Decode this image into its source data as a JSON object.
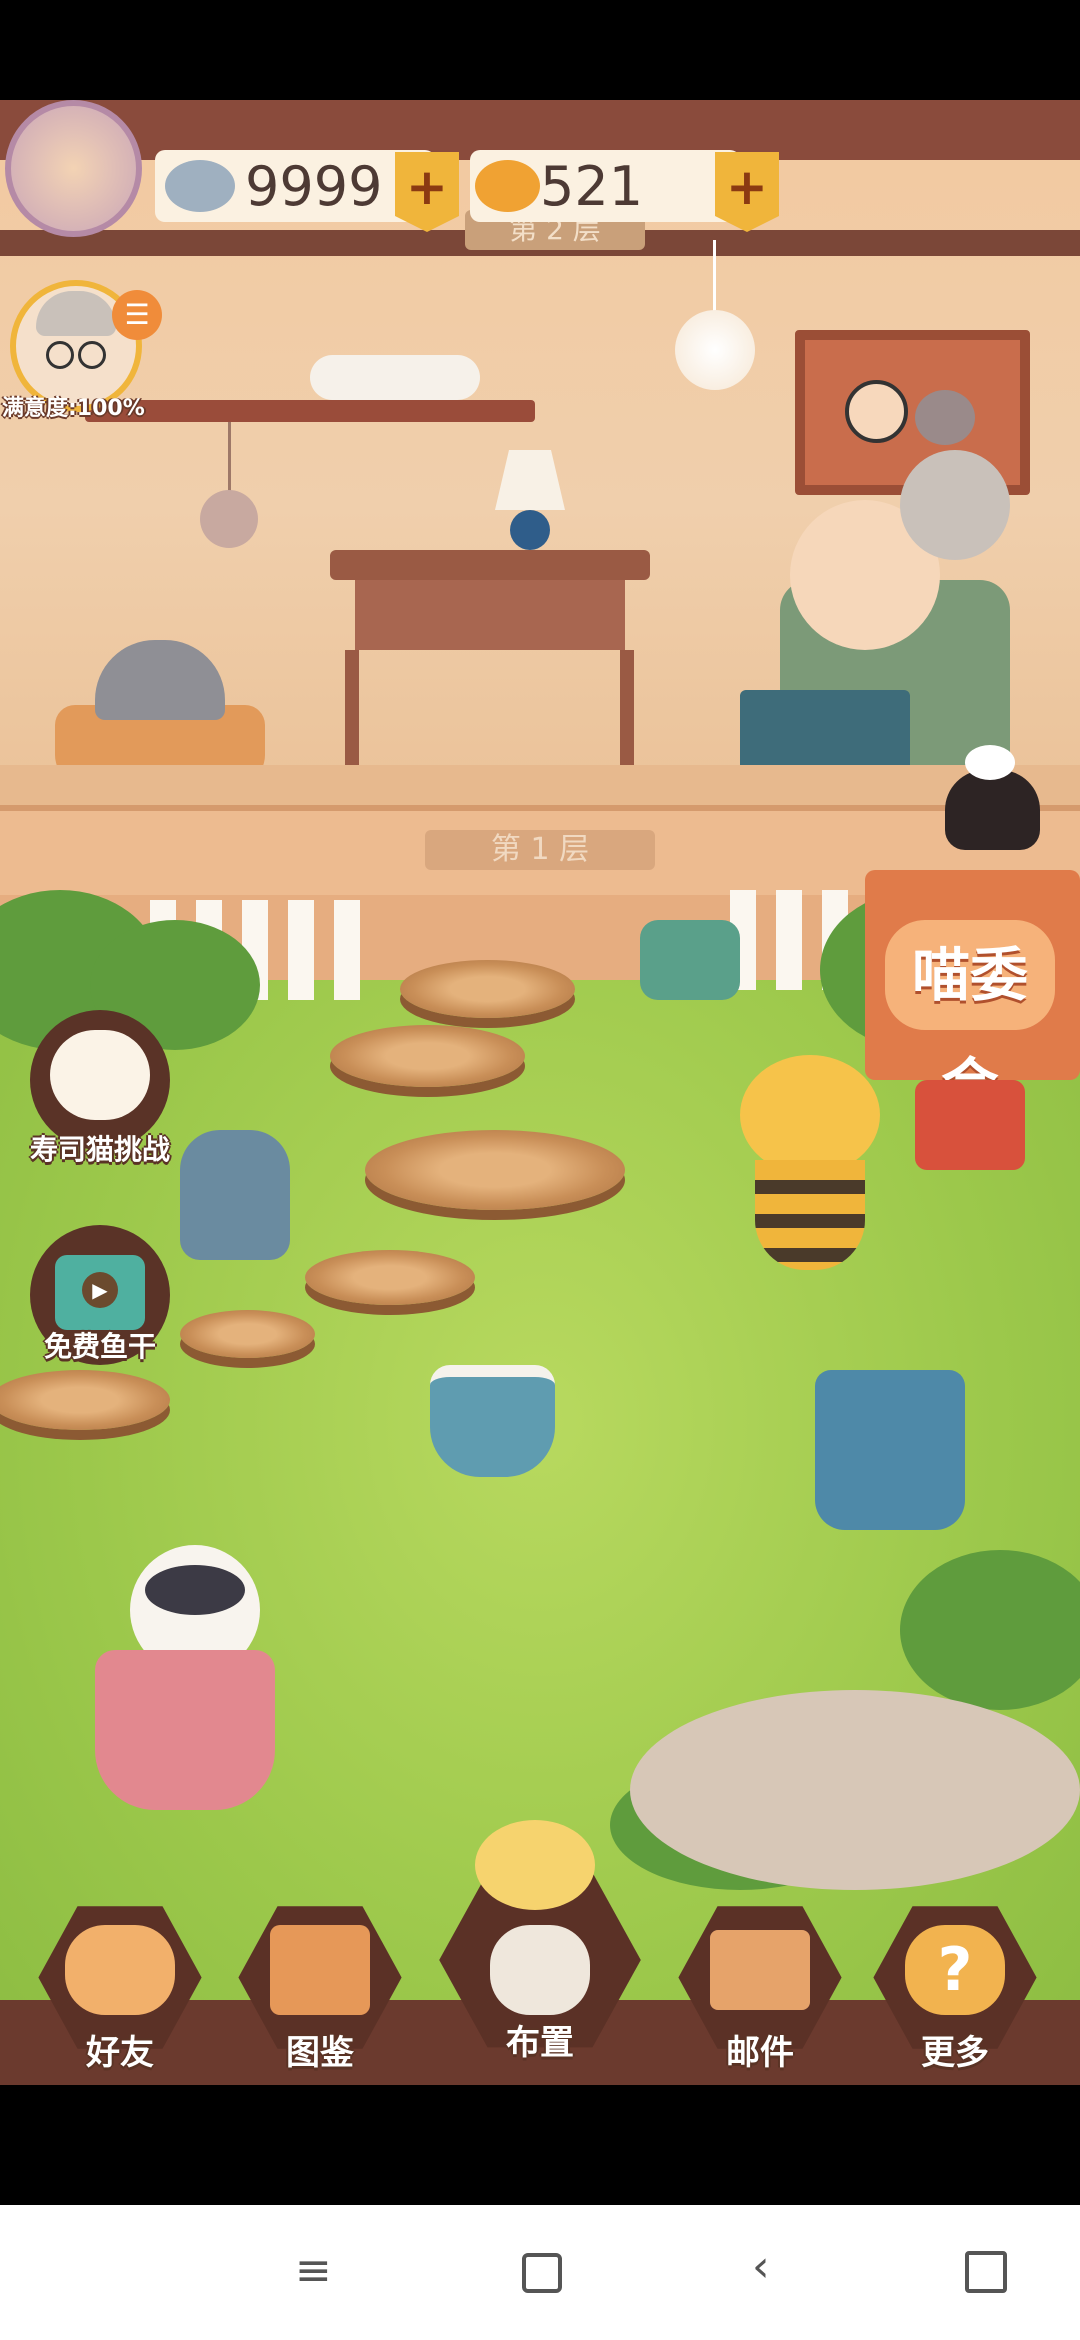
{
  "currency": {
    "fish_dried": {
      "value": "9999",
      "icon": "dried-fish-icon"
    },
    "fish_gold": {
      "value": "521",
      "icon": "golden-fish-icon"
    }
  },
  "floors": {
    "floor2_label": "第 2 层",
    "floor1_label": "第 1 层"
  },
  "grandma": {
    "satisfaction": "满意度:100%"
  },
  "sign": {
    "text": "喵委会"
  },
  "side_buttons": [
    {
      "label": "寿司猫挑战",
      "icon": "sushi-cat-icon"
    },
    {
      "label": "免费鱼干",
      "icon": "tv-play-icon"
    }
  ],
  "bottom_menu": [
    {
      "label": "好友",
      "icon": "friends-icon"
    },
    {
      "label": "图鉴",
      "icon": "cat-book-icon"
    },
    {
      "label": "布置",
      "icon": "flower-vase-icon"
    },
    {
      "label": "邮件",
      "icon": "mail-envelope-icon"
    },
    {
      "label": "更多",
      "icon": "more-question-icon"
    }
  ],
  "navbar": [
    "menu-icon",
    "home-icon",
    "back-icon",
    "screen-rotate-icon"
  ],
  "colors": {
    "accent": "#f0b53b",
    "wood": "#6b3a2e",
    "grass": "#9cc84b"
  }
}
